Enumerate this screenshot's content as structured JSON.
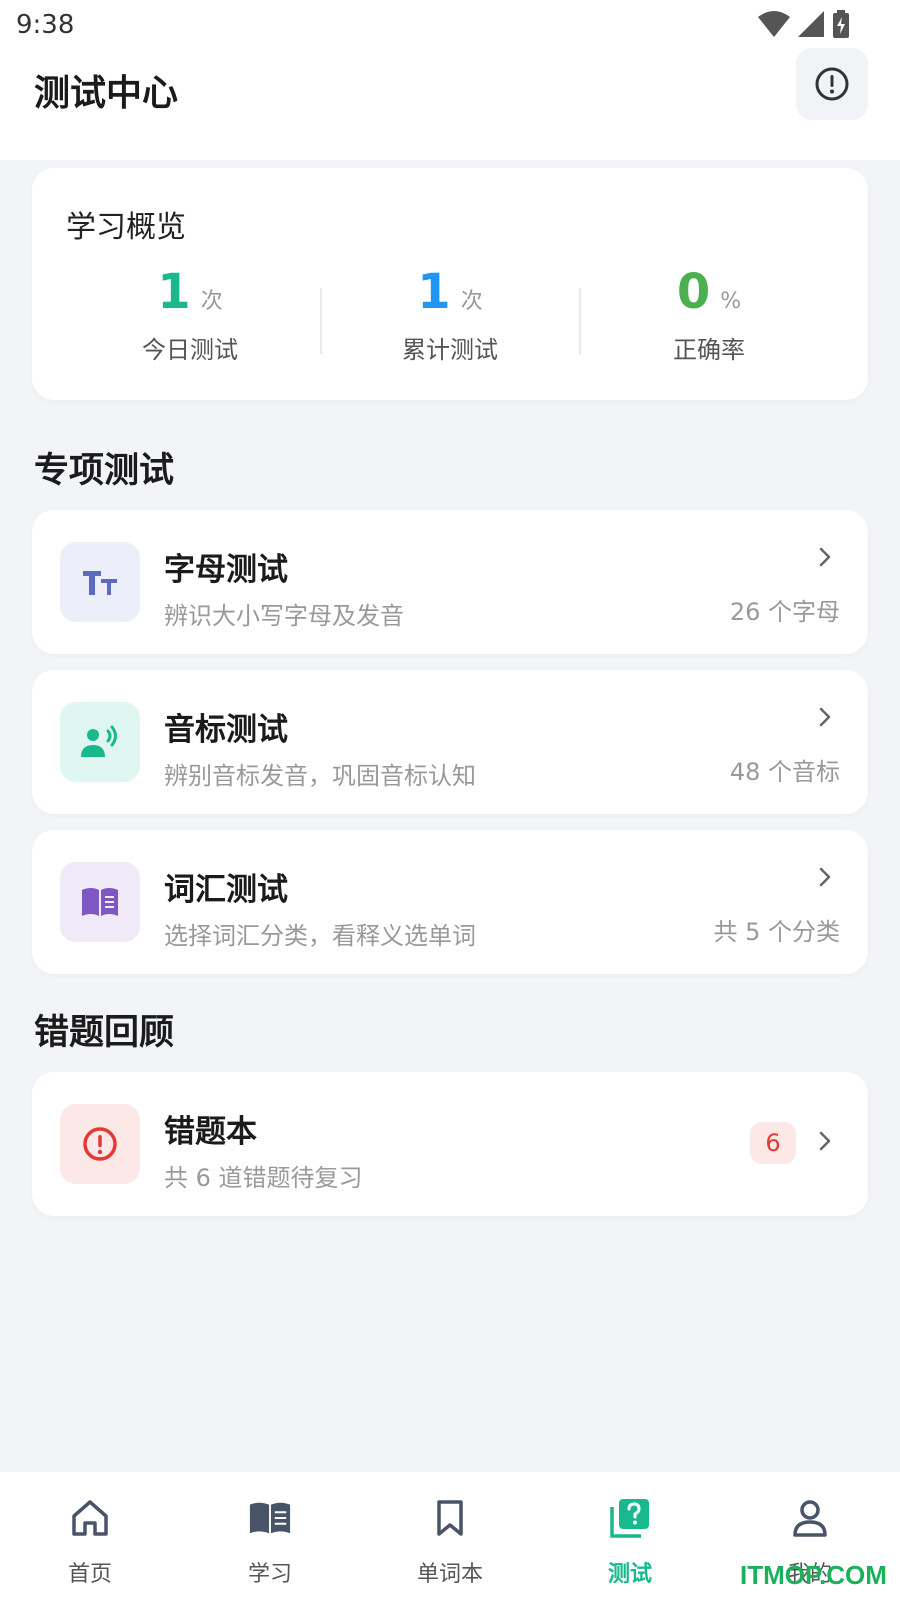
{
  "status": {
    "time": "9:38"
  },
  "header": {
    "title": "测试中心"
  },
  "overview": {
    "title": "学习概览",
    "stats": [
      {
        "value": "1",
        "unit": "次",
        "label": "今日测试",
        "color": "#19b98d"
      },
      {
        "value": "1",
        "unit": "次",
        "label": "累计测试",
        "color": "#2196f3"
      },
      {
        "value": "0",
        "unit": "%",
        "label": "正确率",
        "color": "#4caf50"
      }
    ]
  },
  "special": {
    "title": "专项测试",
    "items": [
      {
        "title": "字母测试",
        "subtitle": "辨识大小写字母及发音",
        "meta": "26 个字母",
        "icon": "text-size-icon",
        "bg": "#eceef9",
        "fg": "#5c6bc0"
      },
      {
        "title": "音标测试",
        "subtitle": "辨别音标发音，巩固音标认知",
        "meta": "48 个音标",
        "icon": "speaker-person-icon",
        "bg": "#e0f7f1",
        "fg": "#19b98d"
      },
      {
        "title": "词汇测试",
        "subtitle": "选择词汇分类，看释义选单词",
        "meta": "共 5 个分类",
        "icon": "open-book-icon",
        "bg": "#efe9f8",
        "fg": "#7e57c2"
      }
    ]
  },
  "review": {
    "title": "错题回顾",
    "item": {
      "title": "错题本",
      "subtitle": "共 6 道错题待复习",
      "badge": "6",
      "icon": "alert-circle-icon",
      "bg": "#fde8e8",
      "fg": "#e53935"
    }
  },
  "nav": [
    {
      "label": "首页",
      "icon": "home-icon"
    },
    {
      "label": "学习",
      "icon": "book-icon"
    },
    {
      "label": "单词本",
      "icon": "bookmark-icon"
    },
    {
      "label": "测试",
      "icon": "quiz-icon",
      "active": true
    },
    {
      "label": "我的",
      "icon": "person-icon"
    }
  ],
  "watermark": "ITMOP.COM"
}
